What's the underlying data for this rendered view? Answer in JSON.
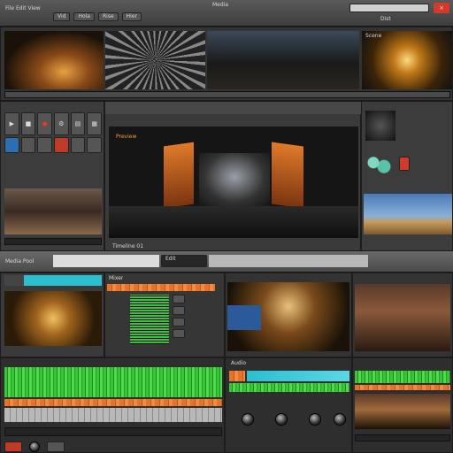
{
  "app": {
    "title_left": "File  Edit  View",
    "title_center": "Media",
    "close_label": "×",
    "accent": "#e8722a",
    "close_color": "#d23a2a"
  },
  "top_bar": {
    "tabs": [
      "Vid",
      "Hola",
      "Rise",
      "Hier"
    ],
    "right_label": "Dist"
  },
  "viewer": {
    "title": "Preview",
    "footer_label": "Timeline 01"
  },
  "top_right": {
    "label": "Scene"
  },
  "mid_strip": {
    "left_label": "Media Pool",
    "center_label": "Edit"
  },
  "bottom_panels": {
    "mixer_label": "Mixer",
    "audio_label": "Audio"
  },
  "icons": [
    "play-icon",
    "stop-icon",
    "record-icon",
    "gear-icon",
    "folder-icon",
    "close-icon"
  ]
}
